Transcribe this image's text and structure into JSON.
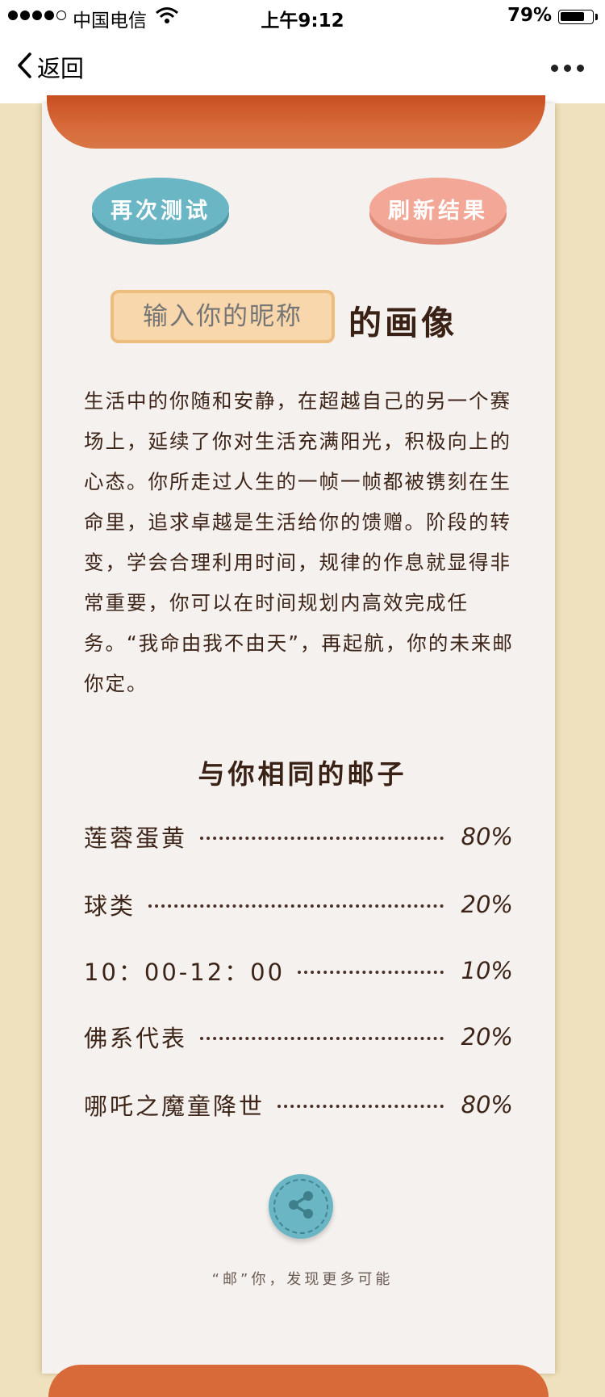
{
  "status_bar": {
    "carrier": "中国电信",
    "time": "上午9:12",
    "battery_percent": "79%",
    "battery_level": 0.79
  },
  "nav": {
    "back_label": "返回"
  },
  "actions": {
    "retest_label": "再次测试",
    "refresh_label": "刷新结果"
  },
  "portrait": {
    "nickname_placeholder": "输入你的昵称",
    "suffix": "的画像"
  },
  "description": "生活中的你随和安静，在超越自己的另一个赛场上，延续了你对生活充满阳光，积极向上的心态。你所走过人生的一帧一帧都被镌刻在生命里，追求卓越是生活给你的馈赠。阶段的转变，学会合理利用时间，规律的作息就显得非常重要，你可以在时间规划内高效完成任务。“我命由我不由天”，再起航，你的未来邮你定。",
  "matches": {
    "title": "与你相同的邮子",
    "items": [
      {
        "name": "莲蓉蛋黄",
        "percent": "80%"
      },
      {
        "name": "球类",
        "percent": "20%"
      },
      {
        "name": "10：00-12：00",
        "percent": "10%"
      },
      {
        "name": "佛系代表",
        "percent": "20%"
      },
      {
        "name": "哪吒之魔童降世",
        "percent": "80%"
      }
    ]
  },
  "footer": {
    "slogan": "“邮”你，发现更多可能"
  },
  "icons": {
    "back": "chevron-left-icon",
    "more": "more-dots-icon",
    "share": "share-icon",
    "wifi": "wifi-icon"
  },
  "colors": {
    "teal": "#6ab6c4",
    "salmon": "#f2a797",
    "orange": "#d86a3a",
    "paper": "#f5f1ee",
    "background": "#efe1bd",
    "text": "#3d2418"
  }
}
